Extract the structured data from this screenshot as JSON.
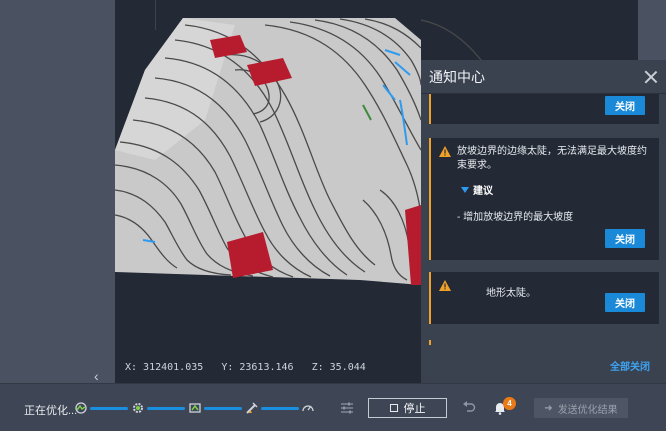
{
  "viewport": {
    "coords": {
      "x": "X: 312401.035",
      "y": "Y: 23613.146",
      "z": "Z: 35.044"
    }
  },
  "notifications": {
    "title": "通知中心",
    "cards": [
      {
        "close_label": "关闭"
      },
      {
        "message": "放坡边界的边缘太陡，无法满足最大坡度约束要求。",
        "suggestion_label": "建议",
        "suggestion_item": "- 增加放坡边界的最大坡度",
        "close_label": "关闭"
      },
      {
        "message": "地形太陡。",
        "close_label": "关闭"
      }
    ],
    "close_all_label": "全部关闭"
  },
  "toolbar": {
    "status": "正在优化...",
    "stop_label": "停止",
    "notification_count": "4",
    "send_label": "发送优化结果"
  },
  "colors": {
    "accent": "#1989d8",
    "warning": "#f0a128",
    "badge": "#e97a17",
    "panel": "#3a414f",
    "card": "#232935"
  }
}
